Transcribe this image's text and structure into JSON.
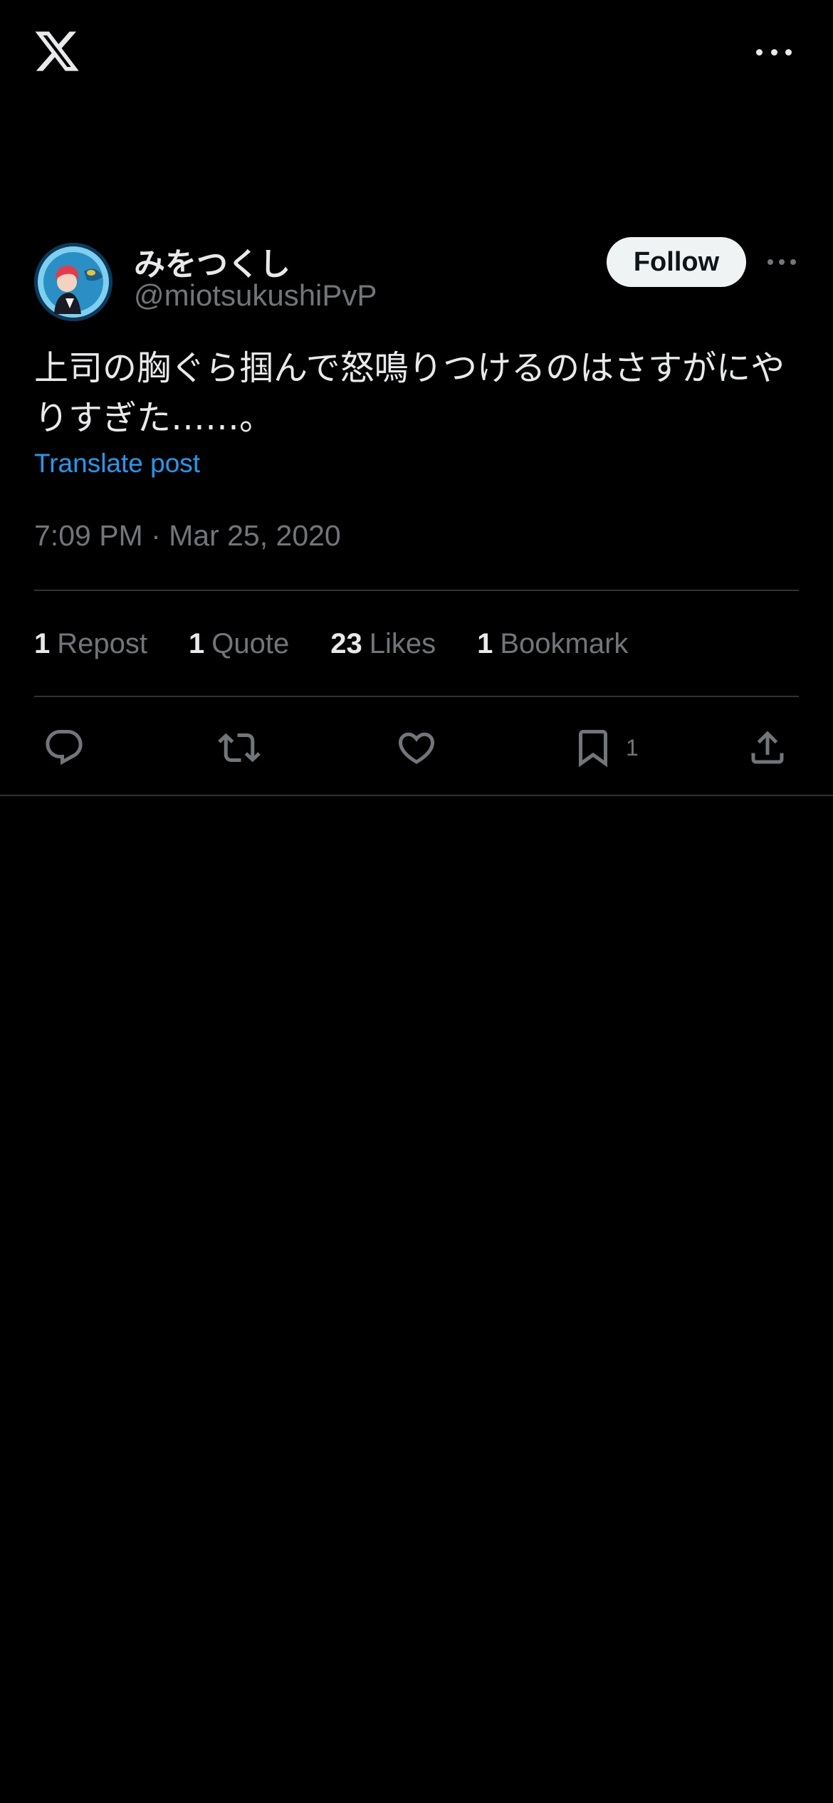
{
  "header": {
    "logo_icon": "x-logo-icon",
    "more_icon": "more-horizontal-icon"
  },
  "author": {
    "display_name": "みをつくし",
    "handle": "@miotsukushiPvP",
    "follow_label": "Follow",
    "avatar_icon": "avatar"
  },
  "post": {
    "text": "上司の胸ぐら掴んで怒鳴りつけるのはさすがにやりすぎた……。",
    "translate_label": "Translate post",
    "timestamp": "7:09 PM · Mar 25, 2020"
  },
  "stats": [
    {
      "count": "1",
      "label": "Repost"
    },
    {
      "count": "1",
      "label": "Quote"
    },
    {
      "count": "23",
      "label": "Likes"
    },
    {
      "count": "1",
      "label": "Bookmark"
    }
  ],
  "actions": {
    "reply_icon": "reply-icon",
    "repost_icon": "repost-icon",
    "like_icon": "heart-icon",
    "bookmark_icon": "bookmark-icon",
    "bookmark_count": "1",
    "share_icon": "share-icon"
  },
  "colors": {
    "background": "#000000",
    "primary_text": "#e7e9ea",
    "secondary_text": "#71767b",
    "link": "#1d9bf0",
    "divider": "#2f3336",
    "follow_button_bg": "#eff3f4"
  }
}
